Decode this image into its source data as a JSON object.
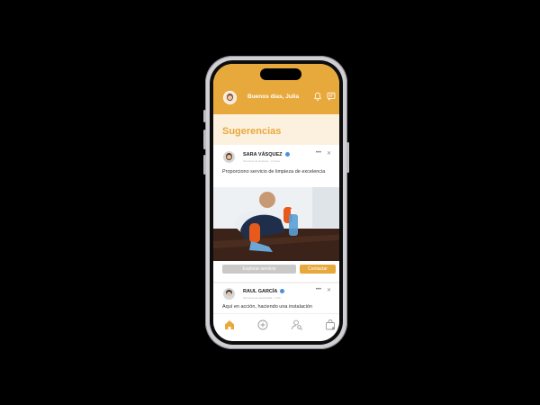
{
  "header": {
    "greeting": "Buenos días, Julia",
    "icons": [
      "bell-icon",
      "message-icon"
    ]
  },
  "section": {
    "title": "Sugerencias"
  },
  "posts": [
    {
      "author": "SARA VÁSQUEZ",
      "subtitle": "Servicios de limpieza · 2 horas",
      "text": "Proporciono servicio de limpieza de excelencia",
      "buttons": {
        "secondary": "Explorar servicio",
        "primary": "Contactar"
      }
    },
    {
      "author": "RAUL GARCÍA",
      "subtitle": "Servicios de electricidad · 1 día",
      "text": "Aquí en acción, haciendo una instalación"
    }
  ],
  "tabbar": [
    "home-icon",
    "add-circle-icon",
    "search-user-icon",
    "bag-icon"
  ],
  "colors": {
    "accent": "#e8a93c",
    "band": "#fcf1df"
  }
}
